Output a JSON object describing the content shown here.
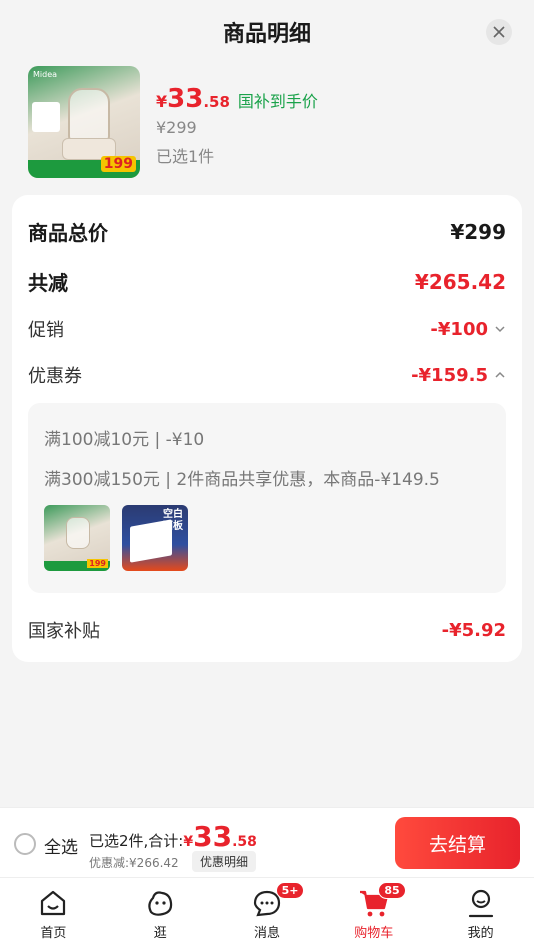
{
  "sheet": {
    "title": "商品明细"
  },
  "product": {
    "currency": "¥",
    "price_int": "33",
    "price_dec": ".58",
    "subsidy_label": "国补到手价",
    "original_price": "¥299",
    "selected": "已选1件",
    "thumb_badge": "199",
    "thumb_brand": "Midea"
  },
  "summary": {
    "total_label": "商品总价",
    "total_value": "¥299",
    "discount_label": "共减",
    "discount_value": "¥265.42",
    "promo_label": "促销",
    "promo_value": "-¥100",
    "coupon_label": "优惠券",
    "coupon_value": "-¥159.5",
    "coupon_lines": [
      "满100减10元 | -¥10",
      "满300减150元 | 2件商品共享优惠，本商品-¥149.5"
    ],
    "coupon_item2_text": "空白面板",
    "subsidy_label": "国家补贴",
    "subsidy_value": "-¥5.92"
  },
  "action_bar": {
    "select_all": "全选",
    "selected_text": "已选2件,合计:",
    "currency": "¥",
    "total_int": "33",
    "total_dec": ".58",
    "discount_text": "优惠减:¥266.42",
    "detail_tag": "优惠明细",
    "checkout_label": "去结算"
  },
  "tabs": [
    {
      "label": "首页",
      "icon": "home-icon"
    },
    {
      "label": "逛",
      "icon": "browse-icon"
    },
    {
      "label": "消息",
      "icon": "message-icon",
      "badge": "5+"
    },
    {
      "label": "购物车",
      "icon": "cart-icon",
      "badge": "85"
    },
    {
      "label": "我的",
      "icon": "profile-icon"
    }
  ],
  "colors": {
    "accent": "#e8232c",
    "subsidy_green": "#1aa24a"
  }
}
